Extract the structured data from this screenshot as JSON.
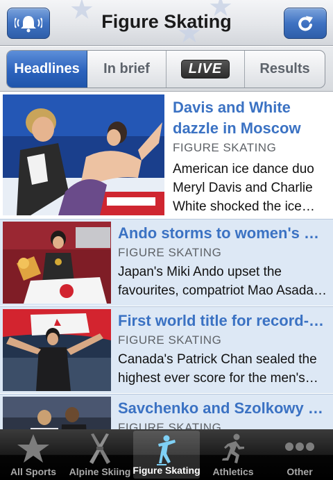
{
  "header": {
    "title": "Figure Skating",
    "left_button_icon": "bell-icon",
    "right_button_icon": "refresh-icon"
  },
  "segments": [
    {
      "label": "Headlines",
      "active": true
    },
    {
      "label": "In brief",
      "active": false
    },
    {
      "label": "LIVE",
      "active": false
    },
    {
      "label": "Results",
      "active": false
    }
  ],
  "articles": [
    {
      "headline": "Davis and White dazzle in Moscow",
      "category": "FIGURE SKATING",
      "summary": "American ice dance duo Meryl Davis and Charlie White shocked the ice dance world",
      "thumb_icon": "ice-dance-photo"
    },
    {
      "headline": "Ando storms to women's world title",
      "category": "FIGURE SKATING",
      "summary": "Japan's Miki Ando upset the favourites, compatriot Mao Asada and Yuna Kim",
      "thumb_icon": "skater-with-flag-photo"
    },
    {
      "headline": "First world title for record-breaking Chan",
      "category": "FIGURE SKATING",
      "summary": "Canada's Patrick Chan sealed the highest ever score for the men's event",
      "thumb_icon": "skater-with-canada-flag-photo"
    },
    {
      "headline": "Savchenko and Szolkowy win pairs",
      "category": "FIGURE SKATING",
      "summary": "",
      "thumb_icon": "pairs-skaters-photo"
    }
  ],
  "tabs": [
    {
      "label": "All Sports",
      "icon": "star-icon",
      "active": false
    },
    {
      "label": "Alpine Skiing",
      "icon": "skis-icon",
      "active": false
    },
    {
      "label": "Figure Skating",
      "icon": "figure-skater-icon",
      "active": true
    },
    {
      "label": "Athletics",
      "icon": "runner-icon",
      "active": false
    },
    {
      "label": "Other",
      "icon": "more-dots-icon",
      "active": false
    }
  ],
  "colors": {
    "accent_blue": "#2c63bd",
    "headline_blue": "#3b72c3",
    "row_highlight": "#dde8f5",
    "tabbar_black": "#000000"
  }
}
